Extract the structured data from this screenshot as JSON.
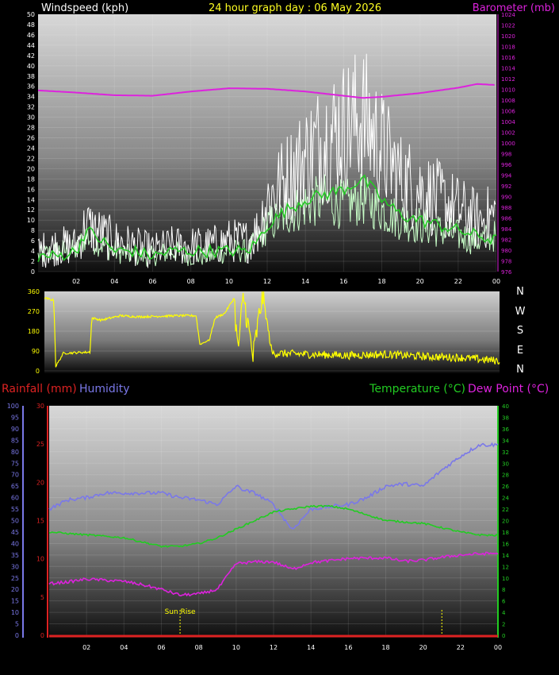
{
  "header": {
    "title": "24 hour graph day : 06 May 2026",
    "wind_label": "Windspeed (kph)",
    "baro_label": "Barometer (mb)"
  },
  "compass": [
    "N",
    "W",
    "S",
    "E",
    "N"
  ],
  "bottom_labels": {
    "rain": "Rainfall (mm)",
    "humidity": "Humidity",
    "temperature": "Temperature (°C)",
    "dewpoint": "Dew Point (°C)"
  },
  "colors": {
    "wind": "#ffffff",
    "gust": "#c8ffc8",
    "wind_avg": "#22cc22",
    "barometer": "#dd22dd",
    "direction": "#ffff00",
    "humidity": "#7a78e8",
    "temperature": "#22cc22",
    "dewpoint": "#dd22dd",
    "rain": "#dd2222",
    "sunline": "#ffff00"
  },
  "chart_data": [
    {
      "type": "line",
      "title": "24 hour graph day : 06 May 2026",
      "x_ticks": [
        "02",
        "04",
        "06",
        "08",
        "10",
        "12",
        "14",
        "16",
        "18",
        "20",
        "22",
        "00"
      ],
      "y_left": {
        "label": "Windspeed (kph)",
        "min": 0,
        "max": 50,
        "ticks": [
          0,
          2,
          4,
          6,
          8,
          10,
          12,
          14,
          16,
          18,
          20,
          22,
          24,
          26,
          28,
          30,
          32,
          34,
          36,
          38,
          40,
          42,
          44,
          46,
          48,
          50
        ]
      },
      "y_right": {
        "label": "Barometer (mb)",
        "min": 976,
        "max": 1024,
        "ticks": [
          976,
          978,
          980,
          982,
          984,
          986,
          988,
          990,
          992,
          994,
          996,
          998,
          1000,
          1002,
          1004,
          1006,
          1008,
          1010,
          1012,
          1014,
          1016,
          1018,
          1020,
          1022,
          1024
        ]
      },
      "series": [
        {
          "name": "Windspeed (kph)",
          "axis": "left",
          "hours": [
            0,
            1,
            2,
            2.5,
            3,
            4,
            5,
            6,
            7,
            8,
            9,
            10,
            11,
            11.5,
            12,
            13,
            14,
            15,
            16,
            17,
            18,
            19,
            20,
            21,
            22,
            23,
            24
          ],
          "values": [
            4,
            5,
            5,
            9,
            8,
            6,
            5,
            4,
            5,
            5,
            5,
            6,
            6,
            8,
            14,
            18,
            22,
            26,
            28,
            30,
            24,
            18,
            16,
            14,
            12,
            10,
            11
          ]
        },
        {
          "name": "Wind gust",
          "axis": "left",
          "hours": [
            0,
            1,
            2,
            2.5,
            3,
            4,
            5,
            6,
            7,
            8,
            9,
            10,
            11,
            11.5,
            12,
            13,
            14,
            15,
            16,
            17,
            18,
            19,
            20,
            21,
            22,
            23,
            24
          ],
          "values": [
            3,
            4,
            4,
            7,
            6,
            4,
            3,
            3,
            4,
            3,
            3,
            4,
            4,
            6,
            9,
            11,
            13,
            14,
            13,
            14,
            12,
            10,
            9,
            8,
            7,
            6,
            7
          ]
        },
        {
          "name": "Wind average",
          "axis": "left",
          "hours": [
            0,
            1,
            2,
            2.5,
            3,
            4,
            5,
            6,
            7,
            8,
            9,
            10,
            11,
            11.5,
            12,
            13,
            14,
            15,
            16,
            17,
            18,
            19,
            20,
            21,
            22,
            23,
            24
          ],
          "values": [
            3,
            3,
            4,
            8,
            7,
            4,
            4,
            3,
            4,
            4,
            4,
            4,
            4,
            6,
            9,
            12,
            14,
            15,
            16,
            18,
            14,
            11,
            10,
            9,
            8,
            7,
            6
          ]
        },
        {
          "name": "Barometer (mb)",
          "axis": "right",
          "hours": [
            0,
            2,
            4,
            6,
            8,
            10,
            12,
            14,
            16,
            17,
            18,
            20,
            22,
            23,
            24
          ],
          "values": [
            1009.8,
            1009.4,
            1008.9,
            1008.8,
            1009.6,
            1010.2,
            1010.1,
            1009.6,
            1008.8,
            1008.4,
            1008.6,
            1009.3,
            1010.3,
            1011.0,
            1010.8
          ]
        }
      ]
    },
    {
      "type": "line",
      "title": "",
      "y": {
        "min": 0,
        "max": 360,
        "ticks": [
          0,
          90,
          180,
          270,
          360
        ]
      },
      "series": [
        {
          "name": "",
          "hours": [
            0,
            0.5,
            0.6,
            1,
            2.4,
            2.5,
            3,
            4,
            5,
            7,
            8,
            8.2,
            8.7,
            9,
            9.5,
            10,
            10.2,
            10.5,
            11,
            11.5,
            12,
            14,
            16,
            18,
            20,
            22,
            24
          ],
          "values": [
            330,
            320,
            20,
            80,
            85,
            240,
            230,
            250,
            245,
            250,
            250,
            120,
            140,
            240,
            260,
            330,
            90,
            340,
            60,
            350,
            80,
            75,
            70,
            75,
            65,
            60,
            45
          ]
        }
      ]
    },
    {
      "type": "line",
      "x_ticks": [
        "02",
        "04",
        "06",
        "08",
        "10",
        "12",
        "14",
        "16",
        "18",
        "20",
        "22",
        "00"
      ],
      "y_humidity": {
        "label": "Humidity",
        "min": 0,
        "max": 100,
        "ticks": [
          0,
          5,
          10,
          15,
          20,
          25,
          30,
          35,
          40,
          45,
          50,
          55,
          60,
          65,
          70,
          75,
          80,
          85,
          90,
          95,
          100
        ]
      },
      "y_rain": {
        "label": "Rainfall (mm)",
        "min": 0,
        "max": 30,
        "ticks": [
          0,
          5,
          10,
          15,
          20,
          25,
          30
        ]
      },
      "y_temp": {
        "label": "Temperature (°C)",
        "min": 0,
        "max": 40,
        "ticks": [
          0,
          2,
          4,
          6,
          8,
          10,
          12,
          14,
          16,
          18,
          20,
          22,
          24,
          26,
          28,
          30,
          32,
          34,
          36,
          38,
          40
        ]
      },
      "annotations": [
        {
          "label": "Sun Rise",
          "hour": 7
        },
        {
          "label": "",
          "hour": 21
        }
      ],
      "series": [
        {
          "name": "Humidity",
          "axis": "humidity",
          "hours": [
            0,
            1,
            2,
            3,
            4,
            5,
            6,
            7,
            8,
            9,
            10,
            10.5,
            11,
            12,
            13,
            14,
            15,
            16,
            17,
            18,
            19,
            20,
            21,
            22,
            23,
            24
          ],
          "values": [
            55,
            59,
            60,
            62,
            62,
            62,
            62,
            60,
            59,
            57,
            65,
            63,
            62,
            57,
            46,
            55,
            56,
            57,
            60,
            65,
            66,
            65,
            72,
            78,
            83,
            83
          ]
        },
        {
          "name": "Temperature (°C)",
          "axis": "temp",
          "hours": [
            0,
            2,
            4,
            6,
            7,
            8,
            9,
            10,
            11,
            12,
            13,
            14,
            15,
            16,
            17,
            18,
            20,
            22,
            23,
            24
          ],
          "values": [
            18,
            17.5,
            17,
            15.5,
            15.5,
            16,
            17,
            18.5,
            20,
            21.5,
            22,
            22.5,
            22.5,
            22,
            21,
            20,
            19.5,
            18,
            17.5,
            17.4
          ]
        },
        {
          "name": "Dew Point (°C)",
          "axis": "temp",
          "hours": [
            0,
            1,
            2,
            4,
            5,
            6,
            7,
            8,
            9,
            10,
            11,
            12,
            13,
            14,
            15,
            16,
            18,
            19,
            20,
            21,
            22,
            23,
            24
          ],
          "values": [
            9,
            9.3,
            9.8,
            9.4,
            8.8,
            8.0,
            7.0,
            7.2,
            8.0,
            12.5,
            12.8,
            12.8,
            11.5,
            12.7,
            13.0,
            13.4,
            13.5,
            12.9,
            13.1,
            13.6,
            14,
            14.2,
            14.3
          ]
        },
        {
          "name": "Rainfall (mm)",
          "axis": "rain",
          "hours": [
            0,
            24
          ],
          "values": [
            0,
            0
          ]
        }
      ]
    }
  ]
}
